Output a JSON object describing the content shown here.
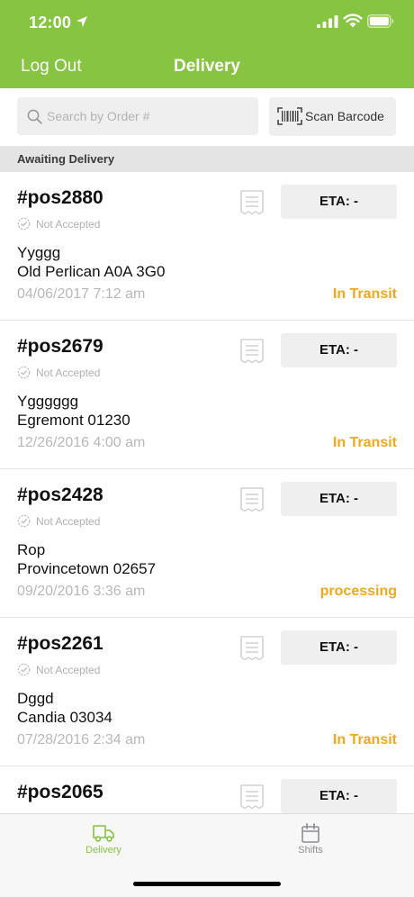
{
  "status_bar": {
    "time": "12:00"
  },
  "nav": {
    "logout_label": "Log Out",
    "title": "Delivery"
  },
  "search": {
    "placeholder": "Search by Order #",
    "value": "",
    "scan_label": "Scan Barcode"
  },
  "section": {
    "title": "Awaiting Delivery"
  },
  "orders": [
    {
      "number": "#pos2880",
      "acceptance": "Not Accepted",
      "customer": "Yyggg",
      "address": "Old Perlican A0A 3G0",
      "datetime": "04/06/2017 7:12 am",
      "status": "In Transit",
      "eta": "ETA: -"
    },
    {
      "number": "#pos2679",
      "acceptance": "Not Accepted",
      "customer": "Ygggggg",
      "address": "Egremont 01230",
      "datetime": "12/26/2016 4:00 am",
      "status": "In Transit",
      "eta": "ETA: -"
    },
    {
      "number": "#pos2428",
      "acceptance": "Not Accepted",
      "customer": "Rop",
      "address": "Provincetown 02657",
      "datetime": "09/20/2016 3:36 am",
      "status": "processing",
      "eta": "ETA: -"
    },
    {
      "number": "#pos2261",
      "acceptance": "Not Accepted",
      "customer": "Dggd",
      "address": "Candia 03034",
      "datetime": "07/28/2016 2:34 am",
      "status": "In Transit",
      "eta": "ETA: -"
    },
    {
      "number": "#pos2065",
      "eta": "ETA: -"
    }
  ],
  "tabs": [
    {
      "label": "Delivery",
      "icon": "truck-icon",
      "active": true
    },
    {
      "label": "Shifts",
      "icon": "calendar-icon",
      "active": false
    }
  ],
  "colors": {
    "brand": "#86c441",
    "status": "#f0a81c",
    "muted": "#b8b8b8",
    "inactive_tab": "#8e8e93"
  }
}
